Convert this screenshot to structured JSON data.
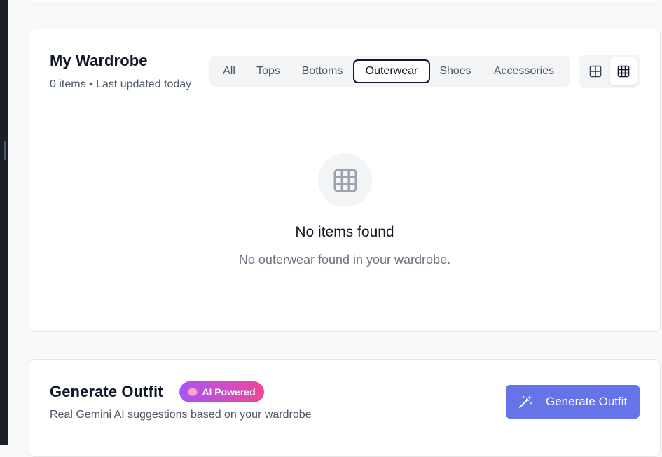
{
  "wardrobe": {
    "title": "My Wardrobe",
    "subtitle": "0 items • Last updated today",
    "filters": [
      "All",
      "Tops",
      "Bottoms",
      "Outerwear",
      "Shoes",
      "Accessories"
    ],
    "active_filter": "Outerwear",
    "view_modes": [
      "large-grid-icon",
      "small-grid-icon"
    ],
    "active_view": "small-grid-icon",
    "empty": {
      "icon": "grid-icon",
      "title": "No items found",
      "description": "No outerwear found in your wardrobe."
    }
  },
  "generate": {
    "title": "Generate Outfit",
    "badge": "AI Powered",
    "badge_icon": "brain-icon",
    "subtitle": "Real Gemini AI suggestions based on your wardrobe",
    "button_label": "Generate Outfit",
    "button_icon": "magic-wand-icon"
  },
  "colors": {
    "accent": "#6674ea",
    "badge_gradient_start": "#a855f7",
    "badge_gradient_end": "#ec4899",
    "page_bg": "#f8f9fb"
  }
}
